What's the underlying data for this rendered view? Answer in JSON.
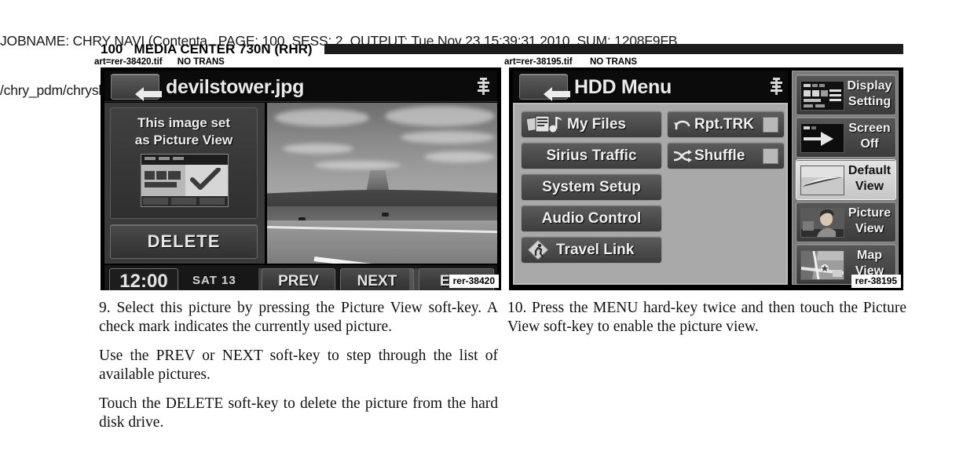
{
  "job_header": {
    "line1": "JOBNAME: CHRY NAVI (Contenta   PAGE: 100  SESS: 2  OUTPUT: Tue Nov 23 15:39:31 2010  SUM: 1208F9FB",
    "line2": "/chry_pdm/chrysler/navi/rhr/navi"
  },
  "figure_header": {
    "page_number": "100",
    "section_title": "MEDIA CENTER 730N (RHR)",
    "combined": "100   MEDIA CENTER 730N (RHR)"
  },
  "art_tags": {
    "left": "art=rer-38420.tif      NO TRANS",
    "right": "art=rer-38195.tif       NO TRANS"
  },
  "left_screen": {
    "art_id": "rer-38420",
    "back_icon": "back-arrow-icon",
    "title": "devilstower.jpg",
    "eq_icon": "equalizer-icon",
    "message_line1": "This image set",
    "message_line2": "as Picture View",
    "thumbnail_icon": "picture-view-thumbnail-check-icon",
    "delete_label": "DELETE",
    "photo_alt": "devils-tower-photo",
    "clock": "12:00",
    "date": "SAT  13",
    "softkeys": [
      {
        "label": "PREV",
        "name": "prev-softkey"
      },
      {
        "label": "NEXT",
        "name": "next-softkey"
      },
      {
        "label": "EXIT",
        "name": "exit-softkey"
      }
    ]
  },
  "right_screen": {
    "art_id": "rer-38195",
    "back_icon": "back-arrow-icon",
    "title": "HDD Menu",
    "eq_icon": "equalizer-icon",
    "menu_col_a": [
      {
        "label": "My Files",
        "icon": "media-files-icon",
        "name": "my-files-button"
      },
      {
        "label": "Sirius Traffic",
        "icon": "",
        "name": "sirius-traffic-button"
      },
      {
        "label": "System Setup",
        "icon": "",
        "name": "system-setup-button"
      },
      {
        "label": "Audio Control",
        "icon": "",
        "name": "audio-control-button"
      },
      {
        "label": "Travel Link",
        "icon": "travel-link-icon",
        "name": "travel-link-button"
      }
    ],
    "menu_col_b": [
      {
        "label": "Rpt.TRK",
        "icon": "repeat-icon",
        "checkbox": true,
        "checked": false,
        "name": "repeat-track-toggle"
      },
      {
        "label": "Shuffle",
        "icon": "shuffle-icon",
        "checkbox": true,
        "checked": false,
        "name": "shuffle-toggle"
      }
    ],
    "side_buttons": [
      {
        "line1": "Display",
        "line2": "Setting",
        "thumb": "display-setting-thumb",
        "active": false,
        "name": "display-setting-button"
      },
      {
        "line1": "Screen",
        "line2": "Off",
        "thumb": "screen-off-thumb",
        "active": false,
        "name": "screen-off-button"
      },
      {
        "line1": "Default",
        "line2": "View",
        "thumb": "default-view-thumb",
        "active": true,
        "name": "default-view-button"
      },
      {
        "line1": "Picture",
        "line2": "View",
        "thumb": "picture-view-thumb",
        "active": false,
        "name": "picture-view-button"
      },
      {
        "line1": "Map",
        "line2": "View",
        "thumb": "map-view-thumb",
        "active": false,
        "name": "map-view-button"
      }
    ]
  },
  "body_text": {
    "left": [
      "9. Select this picture by pressing the Picture View soft-key. A check mark indicates the currently used picture.",
      "Use the PREV or NEXT soft-key to step through the list of available pictures.",
      "Touch the DELETE soft-key to delete the picture from the hard disk drive."
    ],
    "right": [
      "10. Press the MENU hard-key twice and then touch the Picture View soft-key to enable the picture view."
    ]
  },
  "colors": {
    "page_background": "#ffffff",
    "rule": "#1c1c1c",
    "screen_bezel": "#000000",
    "menu_panel": "#a9a9a9",
    "button_face": "#4b4b4b",
    "active_button": "#d8d8d8",
    "text_light": "#f0f0f0"
  }
}
